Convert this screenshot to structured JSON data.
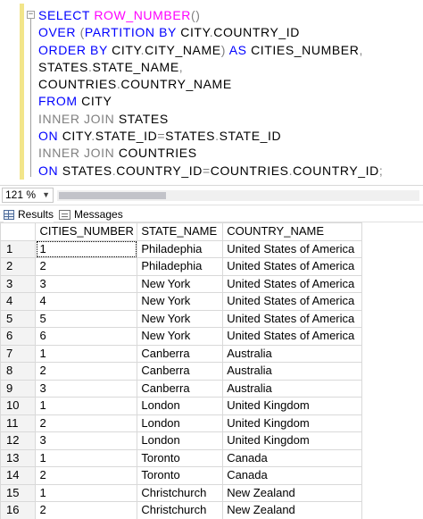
{
  "editor": {
    "lines": [
      [
        {
          "t": "SELECT ",
          "c": "kw"
        },
        {
          "t": "ROW_NUMBER",
          "c": "fn"
        },
        {
          "t": "()",
          "c": "gray"
        }
      ],
      [
        {
          "t": "OVER ",
          "c": "kw"
        },
        {
          "t": "(",
          "c": "gray"
        },
        {
          "t": "PARTITION BY ",
          "c": "kw"
        },
        {
          "t": "CITY",
          "c": "plain"
        },
        {
          "t": ".",
          "c": "gray"
        },
        {
          "t": "COUNTRY_ID",
          "c": "plain"
        }
      ],
      [
        {
          "t": "ORDER BY ",
          "c": "kw"
        },
        {
          "t": "CITY",
          "c": "plain"
        },
        {
          "t": ".",
          "c": "gray"
        },
        {
          "t": "CITY_NAME",
          "c": "plain"
        },
        {
          "t": ") ",
          "c": "gray"
        },
        {
          "t": "AS ",
          "c": "kw"
        },
        {
          "t": "CITIES_NUMBER",
          "c": "plain"
        },
        {
          "t": ",",
          "c": "gray"
        }
      ],
      [
        {
          "t": "STATES",
          "c": "plain"
        },
        {
          "t": ".",
          "c": "gray"
        },
        {
          "t": "STATE_NAME",
          "c": "plain"
        },
        {
          "t": ",",
          "c": "gray"
        }
      ],
      [
        {
          "t": "COUNTRIES",
          "c": "plain"
        },
        {
          "t": ".",
          "c": "gray"
        },
        {
          "t": "COUNTRY_NAME",
          "c": "plain"
        }
      ],
      [
        {
          "t": "FROM ",
          "c": "kw"
        },
        {
          "t": "CITY",
          "c": "plain"
        }
      ],
      [
        {
          "t": "INNER JOIN ",
          "c": "gray"
        },
        {
          "t": "STATES",
          "c": "plain"
        }
      ],
      [
        {
          "t": "ON ",
          "c": "kw"
        },
        {
          "t": "CITY",
          "c": "plain"
        },
        {
          "t": ".",
          "c": "gray"
        },
        {
          "t": "STATE_ID",
          "c": "plain"
        },
        {
          "t": "=",
          "c": "gray"
        },
        {
          "t": "STATES",
          "c": "plain"
        },
        {
          "t": ".",
          "c": "gray"
        },
        {
          "t": "STATE_ID",
          "c": "plain"
        }
      ],
      [
        {
          "t": "INNER JOIN ",
          "c": "gray"
        },
        {
          "t": "COUNTRIES",
          "c": "plain"
        }
      ],
      [
        {
          "t": "ON ",
          "c": "kw"
        },
        {
          "t": "STATES",
          "c": "plain"
        },
        {
          "t": ".",
          "c": "gray"
        },
        {
          "t": "COUNTRY_ID",
          "c": "plain"
        },
        {
          "t": "=",
          "c": "gray"
        },
        {
          "t": "COUNTRIES",
          "c": "plain"
        },
        {
          "t": ".",
          "c": "gray"
        },
        {
          "t": "COUNTRY_ID",
          "c": "plain"
        },
        {
          "t": ";",
          "c": "gray"
        }
      ]
    ],
    "fold_glyph": "−"
  },
  "zoom": {
    "value": "121 %",
    "arrow": "▼"
  },
  "tabs": {
    "results_label": "Results",
    "messages_label": "Messages",
    "results_icon": "grid-icon",
    "messages_icon": "messages-icon"
  },
  "grid": {
    "columns": [
      "CITIES_NUMBER",
      "STATE_NAME",
      "COUNTRY_NAME"
    ],
    "rows": [
      [
        "1",
        "1",
        "Philadephia",
        "United States of America"
      ],
      [
        "2",
        "2",
        "Philadephia",
        "United States of America"
      ],
      [
        "3",
        "3",
        "New York",
        "United States of America"
      ],
      [
        "4",
        "4",
        "New York",
        "United States of America"
      ],
      [
        "5",
        "5",
        "New York",
        "United States of America"
      ],
      [
        "6",
        "6",
        "New York",
        "United States of America"
      ],
      [
        "7",
        "1",
        "Canberra",
        "Australia"
      ],
      [
        "8",
        "2",
        "Canberra",
        "Australia"
      ],
      [
        "9",
        "3",
        "Canberra",
        "Australia"
      ],
      [
        "10",
        "1",
        "London",
        "United Kingdom"
      ],
      [
        "11",
        "2",
        "London",
        "United Kingdom"
      ],
      [
        "12",
        "3",
        "London",
        "United Kingdom"
      ],
      [
        "13",
        "1",
        "Toronto",
        "Canada"
      ],
      [
        "14",
        "2",
        "Toronto",
        "Canada"
      ],
      [
        "15",
        "1",
        "Christchurch",
        "New Zealand"
      ],
      [
        "16",
        "2",
        "Christchurch",
        "New Zealand"
      ]
    ]
  }
}
